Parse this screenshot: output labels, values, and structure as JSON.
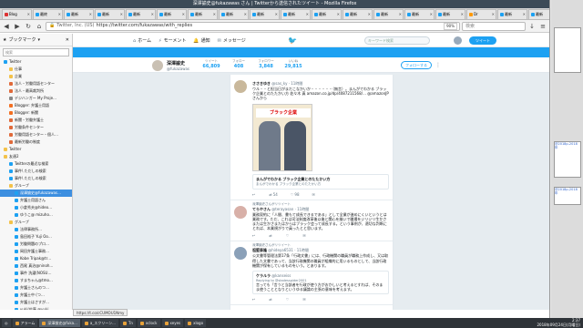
{
  "window": {
    "title": "深澤諭史@fukazawas さん | Twitterから送信されたツイート - Mozilla Firefox"
  },
  "tabs": [
    {
      "label": "Blog",
      "fav": "r"
    },
    {
      "label": "最終",
      "fav": "b"
    },
    {
      "label": "最新",
      "fav": "b"
    },
    {
      "label": "最新",
      "fav": "b"
    },
    {
      "label": "最新",
      "fav": "b"
    },
    {
      "label": "最新",
      "fav": "b"
    },
    {
      "label": "最新",
      "fav": "b"
    },
    {
      "label": "最新",
      "fav": "b"
    },
    {
      "label": "最新",
      "fav": "b"
    },
    {
      "label": "最新",
      "fav": "b"
    },
    {
      "label": "最新",
      "fav": "b"
    },
    {
      "label": "最新",
      "fav": "b"
    },
    {
      "label": "最新",
      "fav": "b"
    },
    {
      "label": "最新",
      "fav": "b"
    },
    {
      "label": "最新",
      "fav": "b"
    },
    {
      "label": "Dr",
      "fav": "o"
    },
    {
      "label": "最新",
      "fav": "b"
    },
    {
      "label": "最新",
      "fav": "b"
    }
  ],
  "toolbar": {
    "url_host": "Twitter, Inc. (US)",
    "url": "https://twitter.com/fukazawas/with_replies",
    "zoom": "90%",
    "search_placeholder": "検索"
  },
  "sidebar": {
    "header": "ブックマーク",
    "search_placeholder": "検索",
    "items": [
      {
        "label": "Twitter",
        "color": "#1da1f2",
        "depth": 0
      },
      {
        "label": "仕事",
        "color": "#f3c24a",
        "depth": 1
      },
      {
        "label": "企業",
        "color": "#f3c24a",
        "depth": 1
      },
      {
        "label": "法人・労働用語センター",
        "color": "#e06a3a",
        "depth": 1
      },
      {
        "label": "法人・最高裁判所",
        "color": "#e06a3a",
        "depth": 1
      },
      {
        "label": "デジハンガー My Proje…",
        "color": "#888",
        "depth": 1
      },
      {
        "label": "Blogger: 弁護士用語",
        "color": "#f36f21",
        "depth": 1
      },
      {
        "label": "Blogger: 新聞",
        "color": "#f36f21",
        "depth": 1
      },
      {
        "label": "新聞・労働弁護士",
        "color": "#e06a3a",
        "depth": 1
      },
      {
        "label": "労働条件センター",
        "color": "#e06a3a",
        "depth": 1
      },
      {
        "label": "労働用語センター・個人…",
        "color": "#e06a3a",
        "depth": 1
      },
      {
        "label": "最新労働の制度",
        "color": "#e06a3a",
        "depth": 1
      },
      {
        "label": "Twitter",
        "color": "#f3c24a",
        "depth": 0
      },
      {
        "label": "友達2",
        "color": "#f3c24a",
        "depth": 0
      },
      {
        "label": "Twitterの最近な検索",
        "color": "#1da1f2",
        "depth": 1
      },
      {
        "label": "事件\\ ただしの検索",
        "color": "#1da1f2",
        "depth": 1
      },
      {
        "label": "事件\\ ただしの検索",
        "color": "#1da1f2",
        "depth": 1
      },
      {
        "label": "グループ",
        "color": "#f3c24a",
        "depth": 1
      },
      {
        "label": "深澤諭史@fukazawas…",
        "color": "#1da1f2",
        "depth": 2,
        "selected": true
      },
      {
        "label": "弁護士用語さん",
        "color": "#1da1f2",
        "depth": 2
      },
      {
        "label": "小倉秀夫@hideo…",
        "color": "#1da1f2",
        "depth": 2
      },
      {
        "label": "ゆうこ@ mizuho…",
        "color": "#1da1f2",
        "depth": 2
      },
      {
        "label": "グループ",
        "color": "#f3c24a",
        "depth": 1
      },
      {
        "label": "法律事務所…",
        "color": "#1da1f2",
        "depth": 2
      },
      {
        "label": "島田裕子 Yuji Oo…",
        "color": "#1da1f2",
        "depth": 2
      },
      {
        "label": "労働問題のプロ…",
        "color": "#1da1f2",
        "depth": 2
      },
      {
        "label": "岡田弁護士事務…",
        "color": "#1da1f2",
        "depth": 2
      },
      {
        "label": "Kobe Tripak@tr…",
        "color": "#1da1f2",
        "depth": 2
      },
      {
        "label": "西尾 真治@ninoh…",
        "color": "#1da1f2",
        "depth": 2
      },
      {
        "label": "事件 洗濯(NOSU…",
        "color": "#1da1f2",
        "depth": 2
      },
      {
        "label": "すまちゃん@tmo…",
        "color": "#1da1f2",
        "depth": 2
      },
      {
        "label": "弁護士さんのつ…",
        "color": "#1da1f2",
        "depth": 2
      },
      {
        "label": "弁護士中 (つ…",
        "color": "#1da1f2",
        "depth": 2
      },
      {
        "label": "弁護士はさすが…",
        "color": "#1da1f2",
        "depth": 2
      },
      {
        "label": "yuki(佐藤 @yuki…",
        "color": "#1da1f2",
        "depth": 2
      },
      {
        "label": "弁護士 人のぼくぼ…",
        "color": "#1da1f2",
        "depth": 2
      },
      {
        "label": "郵便受信@mokuto…",
        "color": "#1da1f2",
        "depth": 2
      },
      {
        "label": "弁護士資格 正…",
        "color": "#1da1f2",
        "depth": 2
      },
      {
        "label": "加藤健二@kokus…",
        "color": "#1da1f2",
        "depth": 2
      }
    ]
  },
  "twitter": {
    "nav": [
      "ホーム",
      "モーメント",
      "通知",
      "メッセージ"
    ],
    "search_placeholder": "キーワード検索",
    "tweet_button": "ツイート",
    "profile": {
      "name": "深澤諭史",
      "handle": "@fukazawas",
      "stats": [
        {
          "label": "ツイート",
          "value": "66,809"
        },
        {
          "label": "フォロー",
          "value": "408"
        },
        {
          "label": "フォロワー",
          "value": "3,848"
        },
        {
          "label": "いいね",
          "value": "29,815"
        }
      ],
      "follow_button": "フォローする"
    },
    "tweets": [
      {
        "context": "",
        "name": "ささきゆき",
        "handle": "@sas_ky · 11時間",
        "text": "ウル・・と担当日がまだこなかいか・・・・・・（無言）。まんがでわかる ブラック企業とのたたかい方 佐々木 真 amazon.co.jp/dp/4087211568/… @amazonJPさんから",
        "book_title": "ブラック企業",
        "card_title": "まんがでわかる ブラック企業とのたたかい方",
        "card_desc": "まんがでわかる ブラック企業とのたたかい方",
        "actions": {
          "reply": "",
          "retweet": "54",
          "like": "98"
        }
      },
      {
        "context": "深澤諭史さんがリツイート",
        "name": "てらやさん",
        "handle": "@terayasan · 11時間",
        "text": "業務契約に「人間、書もて成長できるである」として全業が進めにくいというとは業務です。ただ、これは司法制度改革後以後と関心を継いで職場をジリジリ生かさまたは生かさまたはからはブラック会って成長する。という事例が、適切な判断にとれば、本業規がりで員ったとと思います。",
        "actions": {
          "reply": "",
          "retweet": "",
          "like": ""
        }
      },
      {
        "context": "深澤諭史さんがリツイート",
        "name": "祖堅泰隆",
        "handle": "@hideya6531 · 11時間",
        "text": "公文書等管理法第17条「行政文書」には、行政機関の職員が職務上作成し、又は取得した文書であって、当該行政機関の職員が組織的に用いるものとして、当該行政機関が保有しているものをいう。とあります。",
        "sub_name": "ケラルラ",
        "sub_handle": "@kanseiss",
        "sub_text": "Replying to @stadesspider2001",
        "sub_text2": "言っても「言うと当該者を行政が使う方がおかしいと考えるとすれば、そのまま使うこととなりというゆる議論の主張の意味を考えます。",
        "actions": {
          "reply": "",
          "retweet": "",
          "like": ""
        }
      }
    ]
  },
  "status_url": "https://t.co/cCUMOU1Nmy",
  "taskbar": {
    "items": [
      {
        "label": "アラーム",
        "active": false
      },
      {
        "label": "深澤諭史@fuka...",
        "active": true
      },
      {
        "label": "a_スクリーン...",
        "active": false
      },
      {
        "label": "Tn",
        "active": false
      },
      {
        "label": "xclock",
        "active": false
      },
      {
        "label": "xeyes",
        "active": false
      },
      {
        "label": "xlogo",
        "active": false
      }
    ],
    "time": "2:37",
    "date": "2018年09月24日(月曜日)"
  },
  "right_panel": {
    "thumb1": "@2018p-2018年",
    "thumb2": "@2018p-2018年"
  },
  "colors": {
    "twitter_blue": "#1da1f2",
    "titlebar": "#3c4a57",
    "selected": "#3d8fe0"
  }
}
